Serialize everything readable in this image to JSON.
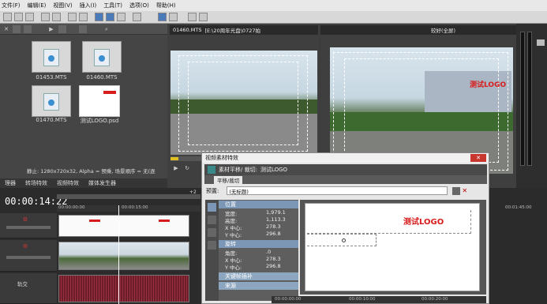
{
  "menu": {
    "items": [
      "文件(F)",
      "编辑(E)",
      "视图(V)",
      "插入(I)",
      "工具(T)",
      "选项(O)",
      "帮助(H)"
    ]
  },
  "media": {
    "files": [
      {
        "name": "01453.MTS",
        "type": "video"
      },
      {
        "name": "01460.MTS",
        "type": "video"
      },
      {
        "name": "01470.MTS",
        "type": "video"
      },
      {
        "name": "测试LOGO.psd",
        "type": "image"
      }
    ],
    "status": "静止: 1280x720x32, Alpha = 预乘, 场景顺序 = 无(逐",
    "tabs": [
      "理器",
      "转场特效",
      "视频特效",
      "媒体发生器"
    ]
  },
  "preview": {
    "clip_label": "01460.MTS",
    "path": "[E:\\20周年光盘\\0727拍",
    "mode_label": "较好(全屏)"
  },
  "timeline": {
    "timecode": "00:00:14:22",
    "ruler": [
      "00:00:00:00",
      "00:00:15:00",
      "00:01:45:00"
    ],
    "bottom_ruler": [
      "00:00:10:00",
      "00:00:20:00"
    ],
    "bus_label": "轨交",
    "marker": "+2"
  },
  "dialog": {
    "window_title": "视频素材特效",
    "header_label": "素材平移/ 裁切:",
    "header_name": "测试LOGO",
    "tab_label": "平移/裁切",
    "preset_label": "预置:",
    "preset_value": "(无标题)",
    "sections": {
      "position": "位置",
      "rotation": "旋转",
      "keyframe": "关键帧插补",
      "source": "来源"
    },
    "params": [
      {
        "label": "宽度:",
        "value": "1,979.1"
      },
      {
        "label": "高度:",
        "value": "1,113.3"
      },
      {
        "label": "X 中心:",
        "value": "278.3"
      },
      {
        "label": "Y 中心:",
        "value": "296.8"
      },
      {
        "label": "角度:",
        "value": ".0"
      },
      {
        "label": "X 中心:",
        "value": "278.3"
      },
      {
        "label": "Y 中心:",
        "value": "296.8"
      }
    ],
    "logo_text": "测试LOGO",
    "ruler": [
      "00:00:00:00",
      "00:00:10:00",
      "00:00:20:00"
    ]
  },
  "overlay": {
    "logo_text": "测试LOGO"
  },
  "colors": {
    "logo_red": "#d81c1c",
    "section_blue": "#7b97b5"
  }
}
